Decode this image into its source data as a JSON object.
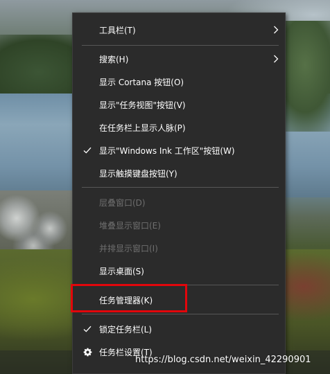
{
  "context_menu": {
    "items": [
      {
        "label": "工具栏(T)",
        "disabled": false,
        "has_submenu": true,
        "checked": false
      },
      {
        "label": "搜索(H)",
        "disabled": false,
        "has_submenu": true,
        "checked": false
      },
      {
        "label": "显示 Cortana 按钮(O)",
        "disabled": false,
        "has_submenu": false,
        "checked": false
      },
      {
        "label": "显示\"任务视图\"按钮(V)",
        "disabled": false,
        "has_submenu": false,
        "checked": false
      },
      {
        "label": "在任务栏上显示人脉(P)",
        "disabled": false,
        "has_submenu": false,
        "checked": false
      },
      {
        "label": "显示\"Windows Ink 工作区\"按钮(W)",
        "disabled": false,
        "has_submenu": false,
        "checked": true
      },
      {
        "label": "显示触摸键盘按钮(Y)",
        "disabled": false,
        "has_submenu": false,
        "checked": false
      },
      {
        "label": "层叠窗口(D)",
        "disabled": true,
        "has_submenu": false,
        "checked": false
      },
      {
        "label": "堆叠显示窗口(E)",
        "disabled": true,
        "has_submenu": false,
        "checked": false
      },
      {
        "label": "并排显示窗口(I)",
        "disabled": true,
        "has_submenu": false,
        "checked": false
      },
      {
        "label": "显示桌面(S)",
        "disabled": false,
        "has_submenu": false,
        "checked": false
      },
      {
        "label": "任务管理器(K)",
        "disabled": false,
        "has_submenu": false,
        "checked": false
      },
      {
        "label": "锁定任务栏(L)",
        "disabled": false,
        "has_submenu": false,
        "checked": true
      },
      {
        "label": "任务栏设置(T)",
        "disabled": false,
        "has_submenu": false,
        "checked": false,
        "icon": "gear-icon"
      }
    ]
  },
  "annotation": {
    "highlight_target": "任务管理器(K)",
    "highlight_color": "#e2060b"
  },
  "watermark": {
    "text": "https://blog.csdn.net/weixin_42290901"
  },
  "colors": {
    "menu_background": "#2b2b2b",
    "menu_text": "#ffffff",
    "disabled_text": "#6f6f6f",
    "separator": "#575757"
  }
}
